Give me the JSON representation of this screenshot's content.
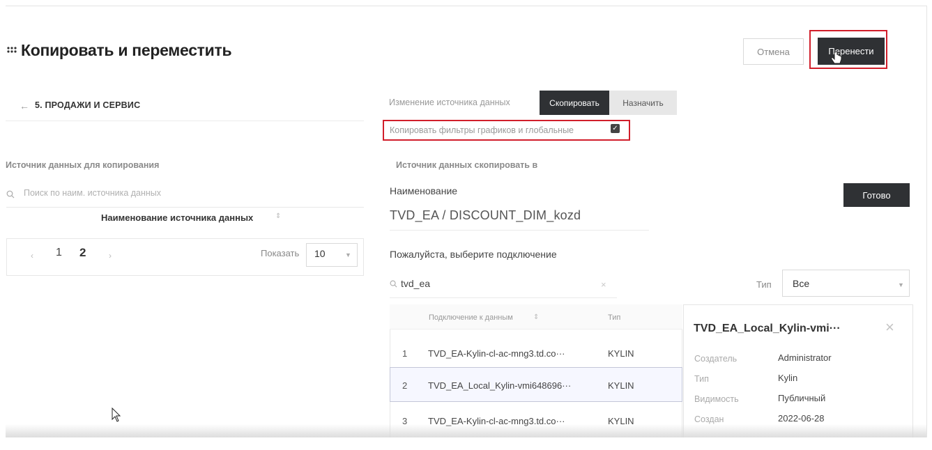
{
  "header": {
    "title": "Копировать и переместить",
    "cancel_label": "Отмена",
    "move_label": "Перенести"
  },
  "left": {
    "back_glyph": "←",
    "breadcrumb": "5. ПРОДАЖИ И СЕРВИС",
    "section_title": "Источник данных для копирования",
    "search_placeholder": "Поиск по наим. источника данных",
    "table_header": "Наименование источника данных",
    "pagination": {
      "pages": [
        "1",
        "2"
      ],
      "current": "2",
      "show_label": "Показать",
      "page_size": "10"
    }
  },
  "right": {
    "change_source_label": "Изменение источника данных",
    "copy_label": "Скопировать",
    "assign_label": "Назначить",
    "copy_filters_label": "Копировать фильтры графиков и глобальные",
    "copy_filters_checked": true,
    "section_title": "Источник данных скопировать в",
    "name_label": "Наименование",
    "name_value": "TVD_EA / DISCOUNT_DIM_kozd",
    "done_label": "Готово",
    "select_connection_label": "Пожалуйста, выберите подключение",
    "search_value": "tvd_ea",
    "type_label": "Тип",
    "type_value": "Все",
    "table": {
      "headers": {
        "connection": "Подключение к данным",
        "type": "Тип"
      },
      "rows": [
        {
          "num": "1",
          "name": "TVD_EA-Kylin-cl-ac-mng3.td.co···",
          "type": "KYLIN"
        },
        {
          "num": "2",
          "name": "TVD_EA_Local_Kylin-vmi648696···",
          "type": "KYLIN"
        },
        {
          "num": "3",
          "name": "TVD_EA-Kylin-cl-ac-mng3.td.co···",
          "type": "KYLIN"
        }
      ]
    },
    "detail": {
      "title": "TVD_EA_Local_Kylin-vmi···",
      "fields": [
        {
          "key": "Создатель",
          "value": "Administrator"
        },
        {
          "key": "Тип",
          "value": "Kylin"
        },
        {
          "key": "Видимость",
          "value": "Публичный"
        },
        {
          "key": "Создан",
          "value": "2022-06-28"
        }
      ]
    }
  },
  "colors": {
    "primary_dark": "#2f3134",
    "highlight_red": "#d11e2a",
    "selected_row_bg": "#f6f7ff"
  }
}
